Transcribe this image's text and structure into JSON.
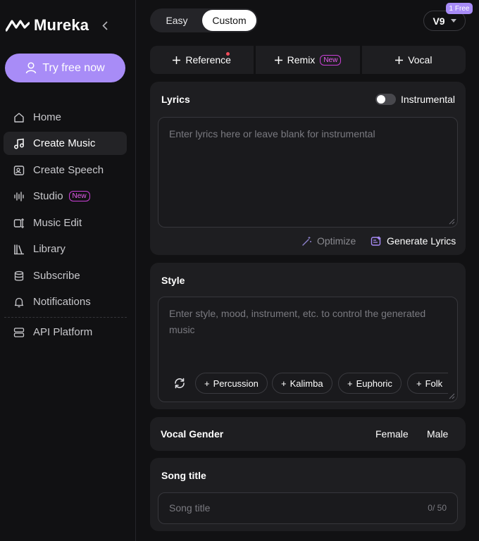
{
  "app": {
    "name": "Mureka"
  },
  "sidebar": {
    "cta": "Try free now",
    "items": [
      {
        "label": "Home"
      },
      {
        "label": "Create Music"
      },
      {
        "label": "Create Speech"
      },
      {
        "label": "Studio",
        "badge": "New"
      },
      {
        "label": "Music Edit"
      },
      {
        "label": "Library"
      },
      {
        "label": "Subscribe"
      },
      {
        "label": "Notifications"
      },
      {
        "label": "API Platform"
      }
    ]
  },
  "header": {
    "modes": [
      "Easy",
      "Custom"
    ],
    "version": "V9",
    "free_badge": "1 Free"
  },
  "tabs": {
    "reference": "Reference",
    "remix": "Remix",
    "remix_badge": "New",
    "vocal": "Vocal"
  },
  "lyrics": {
    "title": "Lyrics",
    "instrumental_label": "Instrumental",
    "placeholder": "Enter lyrics here or leave blank for instrumental",
    "optimize": "Optimize",
    "generate": "Generate Lyrics"
  },
  "style": {
    "title": "Style",
    "placeholder": "Enter style, mood, instrument, etc. to control the generated music",
    "chips": [
      "Percussion",
      "Kalimba",
      "Euphoric",
      "Folk"
    ]
  },
  "vocal_gender": {
    "title": "Vocal Gender",
    "options": [
      "Female",
      "Male"
    ]
  },
  "song_title": {
    "title": "Song title",
    "placeholder": "Song title",
    "counter": "0/ 50"
  },
  "colors": {
    "accent": "#a88cf7",
    "badge": "#e85df0",
    "background": "#111113",
    "panel": "#1e1e21"
  }
}
